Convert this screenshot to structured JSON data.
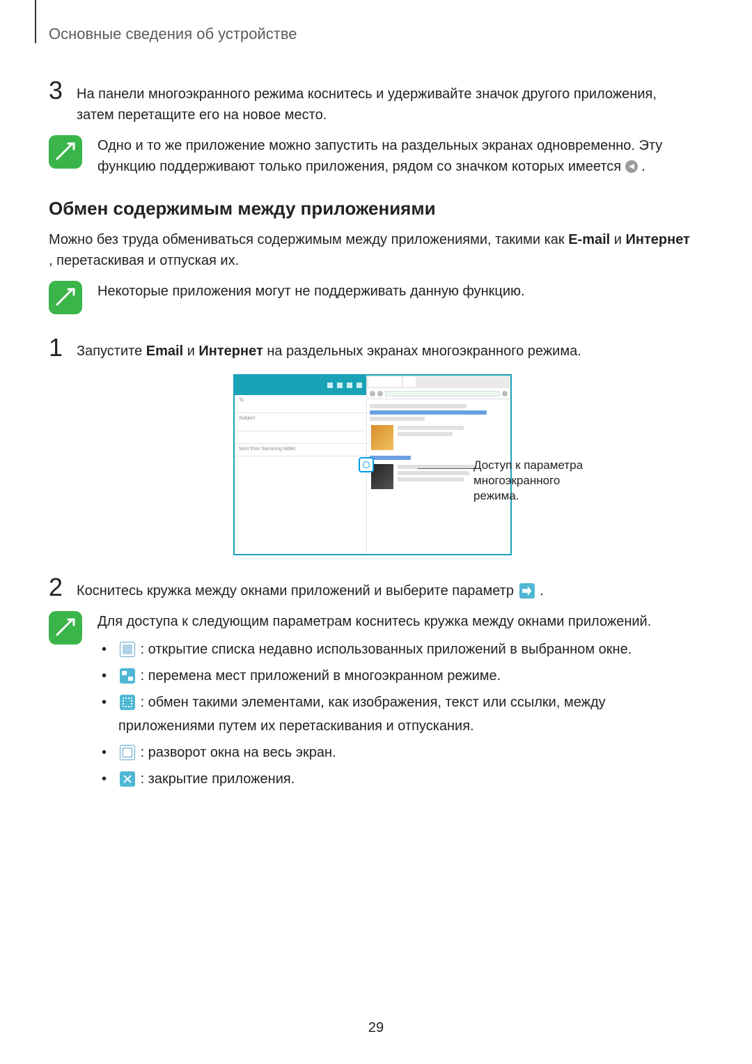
{
  "header": "Основные сведения об устройстве",
  "step3_num": "3",
  "step3_text": "На панели многоэкранного режима коснитесь и удерживайте значок другого приложения, затем перетащите его на новое место.",
  "note1_a": "Одно и то же приложение можно запустить на раздельных экранах одновременно. Эту функцию поддерживают только приложения, рядом со значком которых имеется ",
  "note1_b": ".",
  "section_title": "Обмен содержимым между приложениями",
  "section_body_a": "Можно без труда обмениваться содержимым между приложениями, такими как ",
  "section_body_b": " и ",
  "section_body_c": ", перетаскивая и отпуская их.",
  "bold_email": "E-mail",
  "bold_internet": "Интернет",
  "note2": "Некоторые приложения могут не поддерживать данную функцию.",
  "step1_num": "1",
  "step1_a": "Запустите ",
  "step1_b": " и ",
  "step1_c": " на раздельных экранах многоэкранного режима.",
  "bold_email2": "Email",
  "bold_internet2": "Интернет",
  "callout": "Доступ к параметра многоэкранного режима.",
  "step2_num": "2",
  "step2_a": "Коснитесь кружка между окнами приложений и выберите параметр ",
  "step2_b": ".",
  "note3_intro": "Для доступа к следующим параметрам коснитесь кружка между окнами приложений.",
  "bullets": {
    "b1": ": открытие списка недавно использованных приложений в выбранном окне.",
    "b2": ": перемена мест приложений в многоэкранном режиме.",
    "b3": ": обмен такими элементами, как изображения, текст или ссылки, между приложениями путем их перетаскивания и отпускания.",
    "b4": ": разворот окна на весь экран.",
    "b5": ": закрытие приложения."
  },
  "page_number": "29"
}
